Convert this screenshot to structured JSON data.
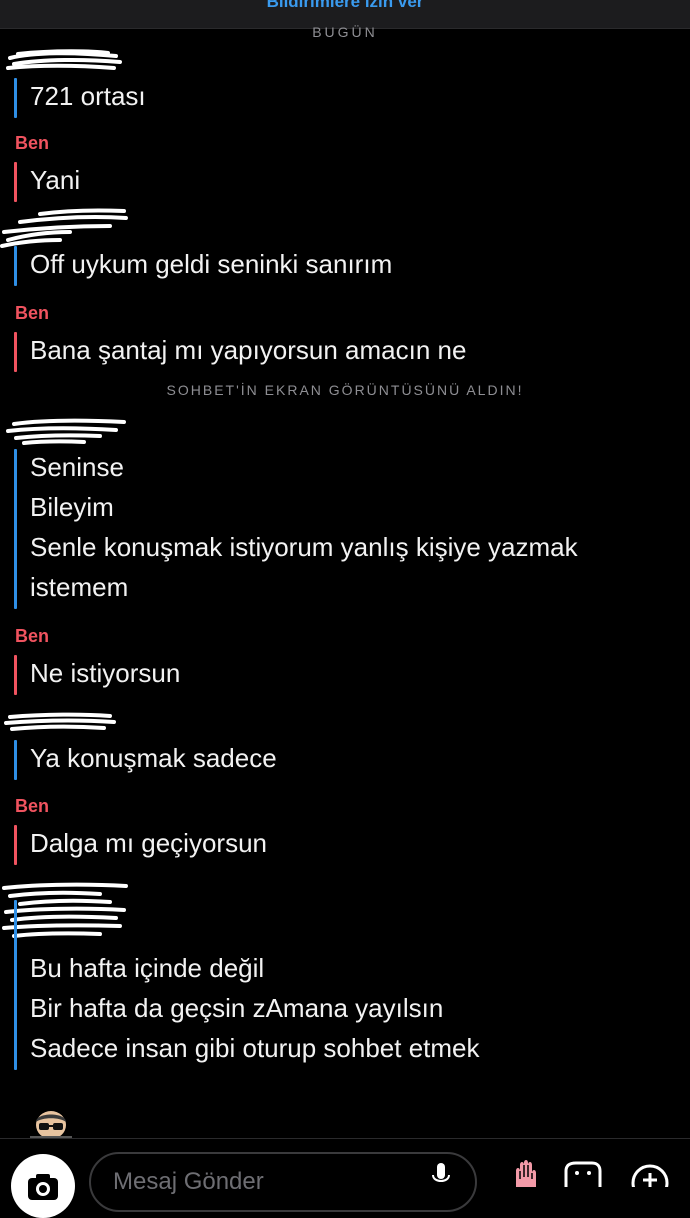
{
  "header": {
    "banner_label": "Bildirimlere izin ver",
    "day_label": "BUGÜN"
  },
  "chat": {
    "me_name": "Ben",
    "system_note": "SOHBET'İN EKRAN GÖRÜNTÜSÜNÜ ALDIN!",
    "messages": [
      {
        "sender": "other",
        "lines": [
          "721 ortası"
        ]
      },
      {
        "sender": "me",
        "lines": [
          "Yani"
        ]
      },
      {
        "sender": "other",
        "lines": [
          "Off uykum geldi seninki sanırım"
        ]
      },
      {
        "sender": "me",
        "lines": [
          "Bana şantaj mı yapıyorsun amacın ne"
        ]
      },
      {
        "sender": "other",
        "lines": [
          "Seninse",
          "Bileyim",
          "Senle konuşmak istiyorum yanlış kişiye yazmak",
          "istemem"
        ]
      },
      {
        "sender": "me",
        "lines": [
          "Ne istiyorsun"
        ]
      },
      {
        "sender": "other",
        "lines": [
          "Ya konuşmak sadece"
        ]
      },
      {
        "sender": "me",
        "lines": [
          "Dalga mı geçiyorsun"
        ]
      },
      {
        "sender": "other",
        "lines": [
          "Bu hafta içinde değil",
          "Bir hafta da geçsin zAmana yayılsın",
          "Sadece insan gibi oturup sohbet etmek"
        ]
      }
    ]
  },
  "composer": {
    "placeholder": "Mesaj Gönder",
    "icons": [
      "camera-icon",
      "mic-icon",
      "emoji-icon",
      "sticker-icon",
      "plus-icon"
    ]
  },
  "colors": {
    "background": "#000000",
    "me": "#f0535f",
    "other": "#2f8fe6",
    "banner_text": "#3a9bef",
    "muted": "#8e8e93"
  }
}
